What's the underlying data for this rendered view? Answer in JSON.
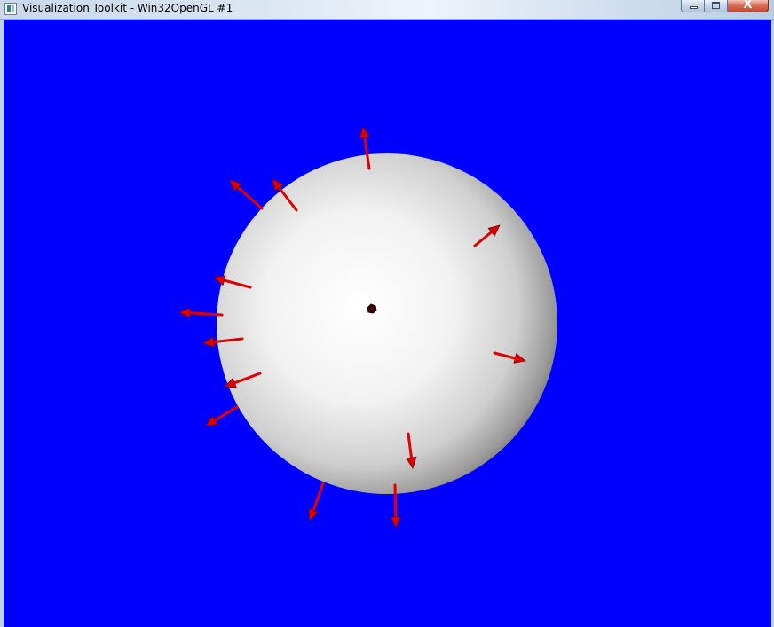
{
  "window": {
    "title": "Visualization Toolkit - Win32OpenGL #1",
    "icon": "vtk-app-icon",
    "buttons": {
      "minimize_icon": "minimize-icon",
      "maximize_icon": "maximize-icon",
      "close_icon": "close-icon",
      "close_glyph": "X"
    }
  },
  "scene": {
    "background_color": "#0000ff",
    "sphere_color": "#ffffff",
    "sphere_shadow_color": "#6f6f6f",
    "glyph_color": "#e00000",
    "center_marker_color": "#3a0000",
    "glyph_type": "arrow",
    "glyph_count": 16
  }
}
